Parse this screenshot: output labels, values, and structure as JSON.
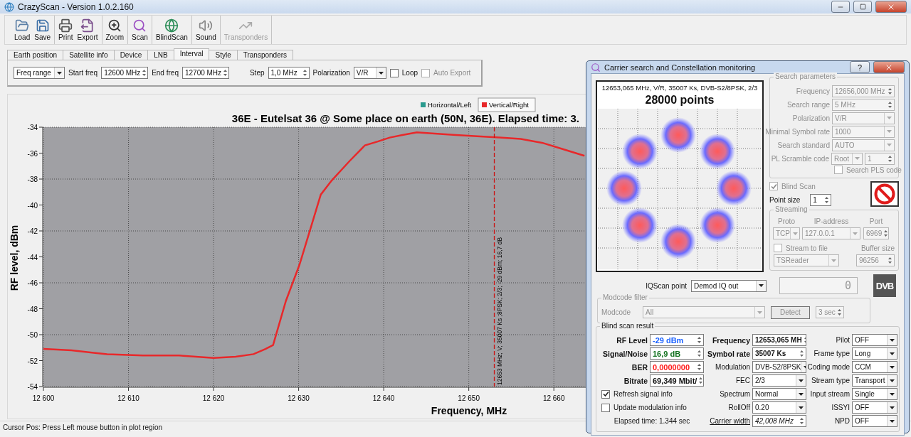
{
  "window": {
    "title": "CrazyScan - Version 1.0.2.160"
  },
  "toolbar": [
    {
      "items": [
        {
          "label": "Load",
          "disabled": false
        },
        {
          "label": "Save",
          "disabled": false
        }
      ]
    },
    {
      "items": [
        {
          "label": "Print",
          "disabled": false
        },
        {
          "label": "Export",
          "disabled": false
        }
      ]
    },
    {
      "items": [
        {
          "label": "Zoom",
          "disabled": false
        }
      ]
    },
    {
      "items": [
        {
          "label": "Scan",
          "disabled": false
        }
      ]
    },
    {
      "items": [
        {
          "label": "BlindScan",
          "disabled": false
        }
      ]
    },
    {
      "items": [
        {
          "label": "Sound",
          "disabled": false
        }
      ]
    },
    {
      "items": [
        {
          "label": "Transponders",
          "disabled": true
        }
      ]
    }
  ],
  "tabs": [
    {
      "label": "Earth position",
      "selected": false
    },
    {
      "label": "Satellite info",
      "selected": false
    },
    {
      "label": "Device",
      "selected": false
    },
    {
      "label": "LNB",
      "selected": false
    },
    {
      "label": "Interval",
      "selected": true
    },
    {
      "label": "Style",
      "selected": false
    },
    {
      "label": "Transponders",
      "selected": false
    }
  ],
  "interval": [
    {
      "kind": "select",
      "value": "Freq range"
    },
    {
      "kind": "label",
      "text": "Start freq"
    },
    {
      "kind": "spin",
      "value": "12600 MHz"
    },
    {
      "kind": "label",
      "text": "End freq"
    },
    {
      "kind": "spin",
      "value": "12700 MHz"
    },
    {
      "kind": "label",
      "text": "Step"
    },
    {
      "kind": "spin",
      "value": "1,0 MHz"
    },
    {
      "kind": "label",
      "text": "Polarization"
    },
    {
      "kind": "select",
      "value": "V/R"
    },
    {
      "kind": "checkbox",
      "label": "Loop",
      "checked": false,
      "disabled": false
    },
    {
      "kind": "checkbox",
      "label": "Auto Export",
      "checked": false,
      "disabled": true
    }
  ],
  "chart": {
    "legend": [
      {
        "label": "Horizontal/Left",
        "color": "#2a9a8e",
        "selected": false
      },
      {
        "selected": true
      }
    ],
    "chart_data": {
      "type": "line",
      "title": "36E - Eutelsat 36 @ Some place on earth (50N, 36E). Elapsed time: 3.",
      "xlabel": "Frequency, MHz",
      "ylabel": "RF level, dBm",
      "x": [
        12600,
        12603.3,
        12605.9,
        12607.5,
        12611.7,
        12615.9,
        12620,
        12622.6,
        12624.7,
        12626.1,
        12627,
        12628.5,
        12630.1,
        12631.5,
        12632.6,
        12633.9,
        12636,
        12637.8,
        12639.3,
        12640.7,
        12642.2,
        12643.9,
        12646,
        12648.5,
        12651,
        12653.6,
        12656.1,
        12658.6,
        12661.1,
        12663.6
      ],
      "series": [
        {
          "name": "Vertical/Right",
          "color": "#e8282a",
          "values": [
            -51.1,
            -51.2,
            -51.4,
            -51.5,
            -51.6,
            -51.6,
            -51.8,
            -51.7,
            -51.5,
            -51.1,
            -50.8,
            -47.4,
            -44.6,
            -41.6,
            -39.2,
            -38.1,
            -36.6,
            -35.4,
            -35.1,
            -34.8,
            -34.6,
            -34.4,
            -34.5,
            -34.6,
            -34.7,
            -34.8,
            -34.9,
            -35.2,
            -35.7,
            -36.2
          ]
        }
      ],
      "xlim": [
        12600,
        12664
      ],
      "ylim": [
        -54,
        -34
      ],
      "xticks": [
        {
          "value": 12600,
          "label": "12 600"
        },
        {
          "value": 12610,
          "label": "12 610"
        },
        {
          "value": 12620,
          "label": "12 620"
        },
        {
          "value": 12630,
          "label": "12 630"
        },
        {
          "value": 12640,
          "label": "12 640"
        },
        {
          "value": 12650,
          "label": "12 650"
        },
        {
          "value": 12660,
          "label": "12 660"
        }
      ],
      "yticks": [
        -34,
        -36,
        -38,
        -40,
        -42,
        -44,
        -46,
        -48,
        -50,
        -52,
        -54
      ],
      "grid": true,
      "ref_lines": [
        {
          "axis": "x",
          "value": 12653,
          "color": "#cc1010",
          "label": "12653 MHz; V; 35007 Ks ;8PSK; 2/3; -29 dBm; 16,7 dB"
        }
      ]
    }
  },
  "status_bar": "Cursor Pos: Press Left mouse button in plot region",
  "dialog": {
    "title": "Carrier search and Constellation monitoring",
    "help": "?",
    "constellation": {
      "info": "12653,065 MHz, V/R, 35007 Ks, DVB-S2/8PSK, 2/3",
      "points": "28000 points"
    },
    "search_parameters": {
      "title": "Search parameters",
      "disabled": true,
      "fields": [
        {
          "label": "Frequency",
          "kind": "spin",
          "value": "12656,000 MHz"
        },
        {
          "label": "Search range",
          "kind": "spin",
          "value": "5 MHz"
        },
        {
          "label": "Polarization",
          "kind": "select",
          "value": "V/R"
        },
        {
          "label": "Minimal Symbol rate",
          "kind": "select",
          "value": "1000"
        },
        {
          "label": "Search standard",
          "kind": "select",
          "value": "AUTO"
        },
        {
          "label": "PL Scramble code",
          "kind": "select-spin",
          "value": "Root",
          "value2": "1"
        }
      ],
      "search_pls": {
        "label": "Search PLS code",
        "checked": false
      }
    },
    "blind_scan": {
      "label": "Blind Scan",
      "checked": true,
      "disabled": true
    },
    "point_size": {
      "label": "Point size",
      "value": "1"
    },
    "streaming": {
      "title": "Streaming",
      "disabled": true,
      "headings": [
        "Proto",
        "IP-address",
        "Port"
      ],
      "proto": "TCP",
      "ip": "127.0.0.1",
      "port": "6969",
      "stream_to_file": {
        "label": "Stream to file",
        "checked": false
      },
      "buffer_label": "Buffer size",
      "reader": "TSReader",
      "buffer": "96256"
    },
    "counter": "0",
    "logo": "DVB",
    "iqscan": {
      "label": "IQScan point",
      "value": "Demod IQ out"
    },
    "modcode_filter": {
      "title": "Modcode filter",
      "disabled": true,
      "label": "Modcode",
      "value": "All",
      "button": "Detect",
      "timeout": "3 sec"
    },
    "result": {
      "title": "Blind scan result",
      "signal": [
        {
          "label": "RF Level",
          "value": "-29 dBm",
          "color": "#1e64ff"
        },
        {
          "label": "Signal/Noise",
          "value": "16,9 dB",
          "color": "#12721f"
        },
        {
          "label": "BER",
          "value": "0,0000000",
          "color": "#ff1a1a"
        },
        {
          "label": "Bitrate",
          "value": "69,349 Mbit/",
          "color": "#111111"
        }
      ],
      "checkboxes": [
        {
          "label": "Refresh signal info",
          "checked": true
        },
        {
          "label": "Update modulation info",
          "checked": false
        }
      ],
      "elapsed": "Elapsed time: 1.344 sec",
      "modulation": [
        {
          "label": "Frequency",
          "value": "12653,065 MH",
          "kind": "spin",
          "bold": true
        },
        {
          "label": "Symbol rate",
          "value": "35007 Ks",
          "kind": "spin",
          "bold": true
        },
        {
          "label": "Modulation",
          "value": "DVB-S2/8PSK",
          "kind": "select",
          "bold": false
        },
        {
          "label": "FEC",
          "value": "2/3",
          "kind": "select",
          "bold": false
        },
        {
          "label": "Spectrum",
          "value": "Normal",
          "kind": "select",
          "bold": false
        },
        {
          "label": "RollOff",
          "value": "0.20",
          "kind": "select",
          "bold": false
        },
        {
          "label": "Carrier width",
          "value": "42,008 MHz",
          "kind": "link-spin",
          "bold": false
        }
      ],
      "stream": [
        {
          "label": "Pilot",
          "value": "OFF"
        },
        {
          "label": "Frame type",
          "value": "Long"
        },
        {
          "label": "Coding mode",
          "value": "CCM"
        },
        {
          "label": "Stream type",
          "value": "Transport"
        },
        {
          "label": "Input stream",
          "value": "Single"
        },
        {
          "label": "ISSYI",
          "value": "OFF"
        },
        {
          "label": "NPD",
          "value": "OFF"
        }
      ]
    }
  }
}
